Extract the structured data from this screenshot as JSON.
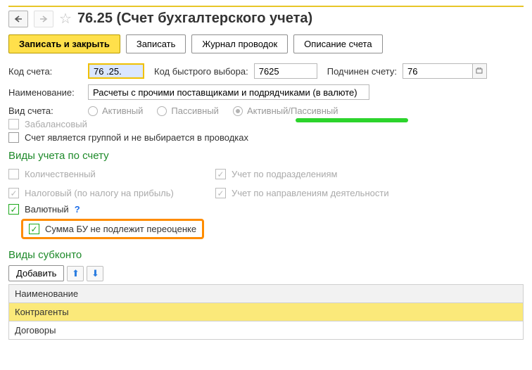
{
  "header": {
    "title": "76.25 (Счет бухгалтерского учета)"
  },
  "actions": {
    "save_close": "Записать и закрыть",
    "save": "Записать",
    "journal": "Журнал проводок",
    "desc": "Описание счета"
  },
  "labels": {
    "code": "Код счета:",
    "fastcode": "Код быстрого выбора:",
    "parent": "Подчинен счету:",
    "name": "Наименование:",
    "acctype": "Вид счета:",
    "offbalance": "Забалансовый",
    "isgroup": "Счет является группой и не выбирается в проводках",
    "acct_types_section": "Виды учета по счету",
    "subconto_section": "Виды субконто",
    "add": "Добавить",
    "col_name": "Наименование"
  },
  "fields": {
    "code": "76 .25.",
    "fastcode": "7625",
    "parent": "76",
    "name": "Расчеты с прочими поставщиками и подрядчиками (в валюте)"
  },
  "radios": {
    "active": "Активный",
    "passive": "Пассивный",
    "activepassive": "Активный/Пассивный"
  },
  "checks": {
    "qty": "Количественный",
    "tax": "Налоговый (по налогу на прибыль)",
    "currency": "Валютный",
    "no_reval": "Сумма БУ не подлежит переоценке",
    "by_dept": "Учет по подразделениям",
    "by_direction": "Учет по направлениям деятельности",
    "help": "?"
  },
  "subconto": {
    "rows": [
      "Контрагенты",
      "Договоры"
    ]
  }
}
